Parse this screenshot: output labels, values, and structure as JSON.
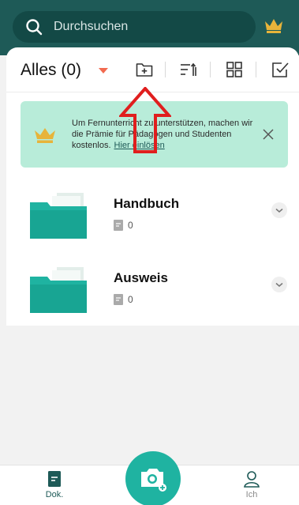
{
  "colors": {
    "brand_dark": "#1e5a57",
    "accent_teal": "#1fb3a1",
    "banner_bg": "#b8ecd9",
    "caret": "#f26a4f",
    "crown": "#e7b43a",
    "annotation_arrow": "#e01e1e"
  },
  "search": {
    "placeholder": "Durchsuchen",
    "icon": "search-icon"
  },
  "header": {
    "title": "Alles (0)",
    "tools": [
      "new-folder-icon",
      "sort-icon",
      "grid-view-icon",
      "select-icon"
    ]
  },
  "banner": {
    "text": "Um Fernunterricht zu unterstützen, machen wir die Prämie für Pädagogen und Studenten kostenlos.",
    "link": "Hier einlösen"
  },
  "folders": [
    {
      "name": "Handbuch",
      "count": "0"
    },
    {
      "name": "Ausweis",
      "count": "0"
    }
  ],
  "nav": {
    "docs_label": "Dok.",
    "me_label": "Ich"
  }
}
